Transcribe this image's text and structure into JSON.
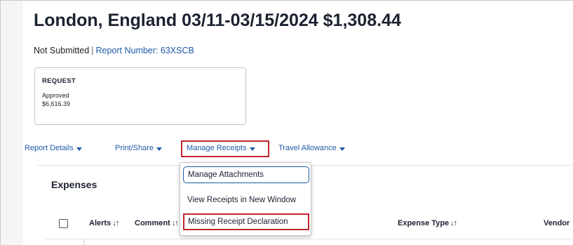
{
  "report": {
    "title": "London, England 03/11-03/15/2024 $1,308.44",
    "status": "Not Submitted",
    "separator": "|",
    "report_number_label": "Report Number: 63XSCB"
  },
  "request_card": {
    "title": "REQUEST",
    "status": "Approved",
    "amount": "$6,616.39"
  },
  "tabs": [
    {
      "label": "Report Details"
    },
    {
      "label": "Print/Share"
    },
    {
      "label": "Manage Receipts"
    },
    {
      "label": "Travel Allowance"
    }
  ],
  "dropdown": {
    "items": [
      {
        "label": "Manage Attachments"
      },
      {
        "label": "View Receipts in New Window"
      },
      {
        "label": "Missing Receipt Declaration"
      }
    ]
  },
  "expenses": {
    "title": "Expenses",
    "columns": [
      {
        "label": "Alerts"
      },
      {
        "label": "Comment"
      },
      {
        "label": "Expense Type"
      },
      {
        "label": "Vendor"
      }
    ],
    "sort_glyph": "↓↑"
  },
  "colors": {
    "link": "#1f5ba8",
    "highlight_border": "#c0272d",
    "title_text": "#1b2231"
  }
}
